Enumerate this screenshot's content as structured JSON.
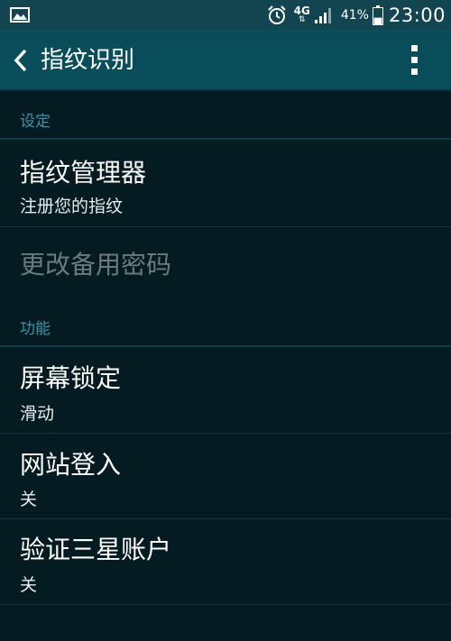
{
  "status_bar": {
    "network": "4G",
    "battery_percent": "41%",
    "battery_level": 0.41,
    "time": "23:00",
    "icons": [
      "gallery-icon",
      "alarm-icon",
      "signal-icon",
      "battery-icon"
    ]
  },
  "action_bar": {
    "title": "指纹识别",
    "icons": [
      "back-arrow-icon",
      "overflow-menu-icon"
    ]
  },
  "sections": {
    "settings_header": "设定",
    "features_header": "功能"
  },
  "items": {
    "fingerprint_manager": {
      "title": "指纹管理器",
      "subtitle": "注册您的指纹"
    },
    "change_backup_password": {
      "title": "更改备用密码",
      "enabled": false
    },
    "screen_lock": {
      "title": "屏幕锁定",
      "subtitle": "滑动"
    },
    "web_signin": {
      "title": "网站登入",
      "subtitle": "关"
    },
    "verify_samsung_account": {
      "title": "验证三星账户",
      "subtitle": "关"
    }
  },
  "colors": {
    "background": "#041b21",
    "action_bar": "#0a4d5a",
    "status_bar": "#12454f",
    "section_header": "#3e93a8",
    "disabled_text": "#6c7a7d"
  }
}
